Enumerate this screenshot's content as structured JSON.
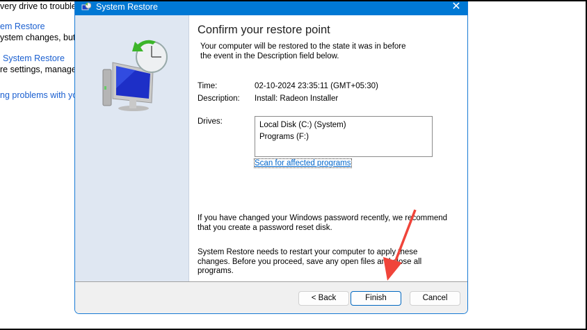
{
  "background": {
    "lines": [
      "very drive to troubles",
      "em Restore",
      "ystem changes, but",
      "System Restore",
      "re settings, manage",
      "ng problems with yo"
    ]
  },
  "dialog": {
    "title": "System Restore",
    "heading": "Confirm your restore point",
    "intro": "Your computer will be restored to the state it was in before the event in the Description field below.",
    "time_label": "Time:",
    "time_value": "02-10-2024 23:35:11 (GMT+05:30)",
    "description_label": "Description:",
    "description_value": "Install: Radeon Installer",
    "drives_label": "Drives:",
    "drives": [
      "Local Disk (C:) (System)",
      "Programs (F:)"
    ],
    "scan_link": "Scan for affected programs",
    "password_note": "If you have changed your Windows password recently, we recommend that you create a password reset disk.",
    "restart_note": "System Restore needs to restart your computer to apply these changes. Before you proceed, save any open files and close all programs.",
    "buttons": {
      "back": "< Back",
      "finish": "Finish",
      "cancel": "Cancel"
    }
  },
  "colors": {
    "titlebar": "#0078d4",
    "annotation_arrow": "#f0443a"
  }
}
